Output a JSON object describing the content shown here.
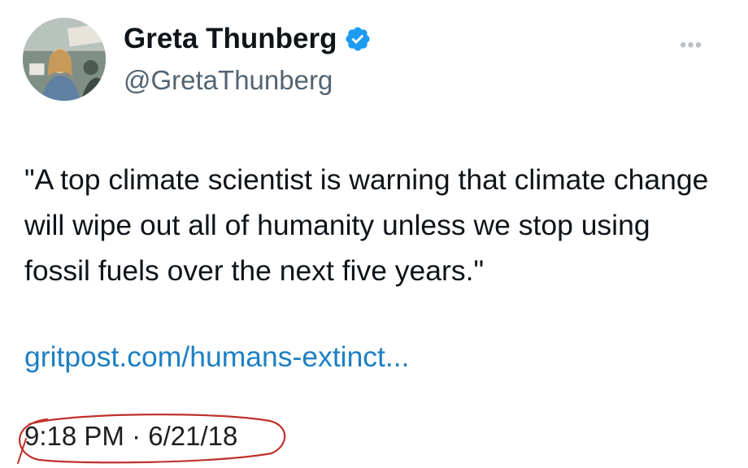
{
  "tweet": {
    "author_name": "Greta Thunberg",
    "handle": "@GretaThunberg",
    "verified": true,
    "more_label": "•••",
    "text": "\"A top climate scientist is warning that climate change will wipe out all of humanity unless we stop using fossil fuels over the next five years.\"",
    "link_text": "gritpost.com/humans-extinct...",
    "timestamp": "9:18 PM · 6/21/18"
  },
  "icons": {
    "verified": "verified-badge-icon",
    "more": "more-options-icon"
  },
  "colors": {
    "text": "#0f1419",
    "handle": "#536471",
    "link": "#1d7fc4",
    "verified": "#1d9bf0",
    "annotation": "#c0312b"
  }
}
